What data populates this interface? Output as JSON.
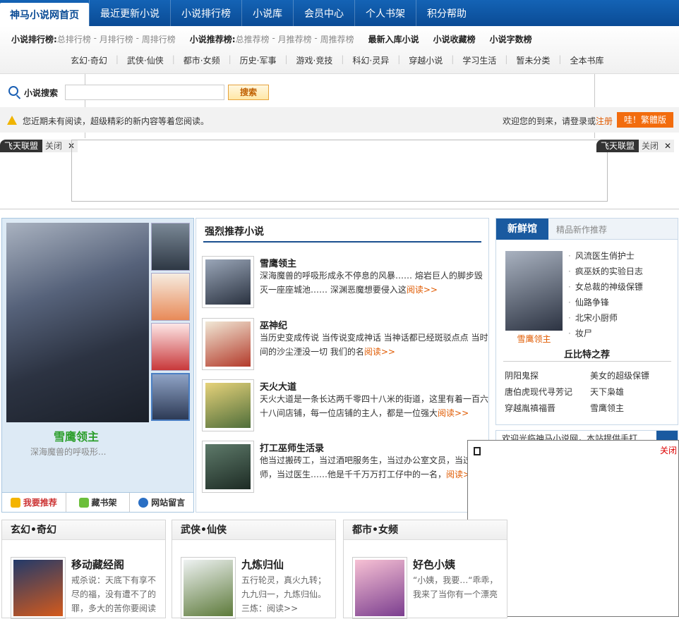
{
  "topnav": {
    "home": "神马小说网首页",
    "items": [
      "最近更新小说",
      "小说排行榜",
      "小说库",
      "会员中心",
      "个人书架",
      "积分帮助"
    ]
  },
  "subnav": {
    "rank_label": "小说排行榜:",
    "rank_links": [
      "总排行榜",
      "月排行榜",
      "周排行榜"
    ],
    "rec_label": "小说推荐榜:",
    "rec_links": [
      "总推荐榜",
      "月推荐榜",
      "周推荐榜"
    ],
    "extra": [
      "最新入库小说",
      "小说收藏榜",
      "小说字数榜"
    ],
    "categories": [
      "玄幻·奇幻",
      "武侠·仙侠",
      "都市·女频",
      "历史·军事",
      "游戏·竞技",
      "科幻·灵异",
      "穿越小说",
      "学习生活",
      "暂未分类",
      "全本书库"
    ]
  },
  "search": {
    "label": "小说搜索",
    "placeholder": "",
    "button": "搜索"
  },
  "notice": {
    "message": "您近期未有阅读，超级精彩的新内容等着您阅读。",
    "welcome": "欢迎您的到来，请登录或",
    "register": "注册",
    "traditional": "哇！繁體版"
  },
  "ad": {
    "tag": "飞天联盟",
    "close": "关闭"
  },
  "featured": {
    "title": "雪鹰领主",
    "desc": "深海魔兽的呼吸形...",
    "actions": [
      "我要推荐",
      "藏书架",
      "网站留言"
    ]
  },
  "recommend": {
    "heading": "强烈推荐小说",
    "read_label": "阅读>>",
    "items": [
      {
        "name": "雪鹰领主",
        "desc": "深海魔兽的呼吸形成永不停息的风暴…… 熔岩巨人的脚步毁灭一座座城池…… 深渊恶魔想要侵入这"
      },
      {
        "name": "巫神纪",
        "desc": "当历史变成传说 当传说变成神话 当神话都已经斑驳点点 当时间的沙尘湮没一切 我们的名"
      },
      {
        "name": "天火大道",
        "desc": "天火大道是一条长达两千零四十八米的街道，这里有着一百六十八间店铺，每一位店铺的主人，都是一位强大"
      },
      {
        "name": "打工巫师生活录",
        "desc": "他当过搬砖工，当过酒吧服务生，当过办公室文员，当过",
        "desc2": "师，当过医生……他是千千万万打工仔中的一名，"
      }
    ]
  },
  "right": {
    "tab_active": "新鲜馆",
    "tab_other": "精品新作推荐",
    "pick_name": "雪鹰领主",
    "list": [
      "风流医生俏护士",
      "疯巫妖的实验日志",
      "女总裁的神级保镖",
      "仙路争锋",
      "北宋小厨师",
      "妆尸"
    ],
    "qbt_title": "丘比特之荐",
    "qbt": [
      "阴阳鬼探",
      "美女的超级保镖",
      "唐伯虎现代寻芳记",
      "天下枭雄",
      "穿越胤禛福晋",
      "雪鹰领主"
    ],
    "welcome": "欢迎光临神马小说网，本站提供手打"
  },
  "popup": {
    "close": "关闭"
  },
  "sections": [
    {
      "title": "玄幻•奇幻",
      "book": "移动藏经阁",
      "desc": "戒杀说：天底下有享不尽的福，没有遭不了的罪，多大的苦你要",
      "read": "阅读"
    },
    {
      "title": "武侠•仙侠",
      "book": "九炼归仙",
      "desc": "五行轮灵，真火九转；九九归一，九炼归仙。三炼：",
      "read": "阅读>>"
    },
    {
      "title": "都市•女频",
      "book": "好色小姨",
      "desc": "“小姨，我要…“乖乖，我来了当你有一个漂亮",
      "read": ""
    }
  ],
  "colors": {
    "nav": "#0a4b95",
    "accent": "#e05a00",
    "green": "#2b9e2b"
  }
}
